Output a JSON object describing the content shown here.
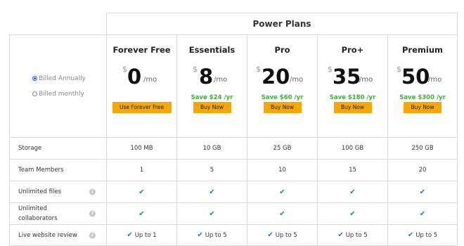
{
  "header": {
    "title": "Power Plans"
  },
  "billing": {
    "options": [
      {
        "label": "Billed Annually",
        "selected": true
      },
      {
        "label": "Billed monthly",
        "selected": false
      }
    ]
  },
  "plans": [
    {
      "name": "Forever Free",
      "currency": "$",
      "amount": "0",
      "per": "/mo",
      "save": "",
      "button": "Use Forever Free"
    },
    {
      "name": "Essentials",
      "currency": "$",
      "amount": "8",
      "per": "/mo",
      "save": "Save $24 /yr",
      "button": "Buy Now"
    },
    {
      "name": "Pro",
      "currency": "$",
      "amount": "20",
      "per": "/mo",
      "save": "Save $60 /yr",
      "button": "Buy Now"
    },
    {
      "name": "Pro+",
      "currency": "$",
      "amount": "35",
      "per": "/mo",
      "save": "Save $180 /yr",
      "button": "Buy Now"
    },
    {
      "name": "Premium",
      "currency": "$",
      "amount": "50",
      "per": "/mo",
      "save": "Save $300 /yr",
      "button": "Buy Now"
    }
  ],
  "features": [
    {
      "label": "Storage",
      "info": false,
      "values": [
        "100 MB",
        "10 GB",
        "25 GB",
        "100 GB",
        "250 GB"
      ]
    },
    {
      "label": "Team Members",
      "info": false,
      "values": [
        "1",
        "5",
        "10",
        "15",
        "20"
      ]
    },
    {
      "label": "Unlimited files",
      "info": true,
      "values": [
        "check",
        "check",
        "check",
        "check",
        "check"
      ]
    },
    {
      "label_lines": [
        "Unlimited",
        "collaborators"
      ],
      "info": true,
      "values": [
        "check",
        "check",
        "check",
        "check",
        "check"
      ]
    },
    {
      "label": "Live website review",
      "info": true,
      "values": [
        "Up to 1",
        "Up to 5",
        "Up to 5",
        "Up to 5",
        "Up to 5"
      ]
    }
  ],
  "icons": {
    "check": "check-icon",
    "info": "info-icon",
    "radio": "radio-icon"
  },
  "colors": {
    "accent_button": "#f6a800",
    "save_green": "#3bb33b",
    "check_blue": "#1f7ad4",
    "border": "#d9d9d9"
  }
}
